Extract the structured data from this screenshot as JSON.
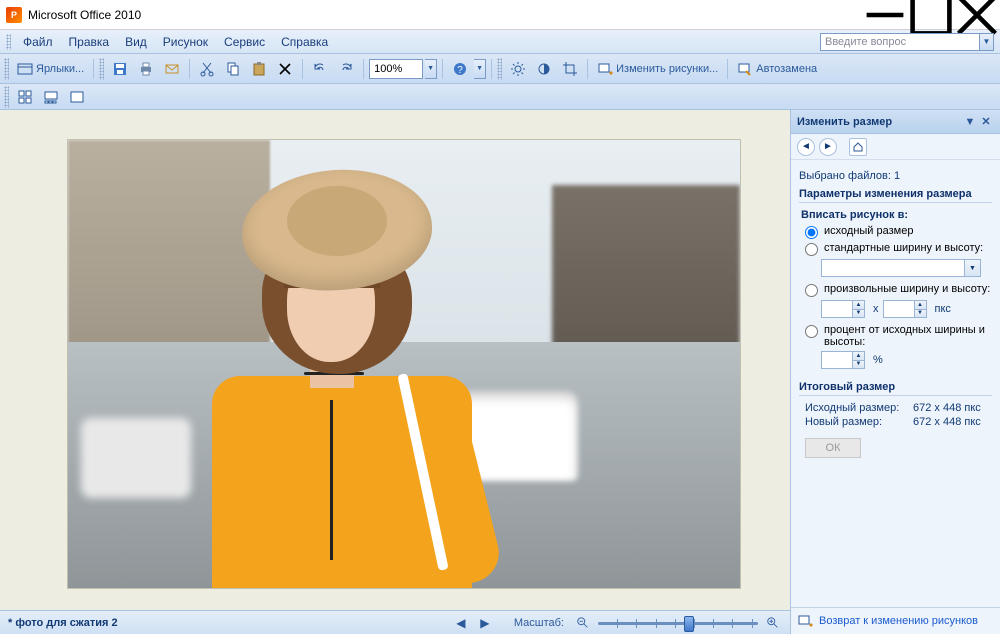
{
  "app": {
    "title": "Microsoft Office 2010"
  },
  "menu": {
    "file": "Файл",
    "edit": "Правка",
    "view": "Вид",
    "picture": "Рисунок",
    "service": "Сервис",
    "help": "Справка",
    "ask_placeholder": "Введите вопрос"
  },
  "toolbar": {
    "shortcuts": "Ярлыки...",
    "zoom_value": "100%",
    "edit_pictures": "Изменить рисунки...",
    "autocorrect": "Автозамена"
  },
  "panel": {
    "title": "Изменить размер",
    "selected_prefix": "Выбрано файлов:",
    "selected_count": "1",
    "params_title": "Параметры изменения размера",
    "fit_label": "Вписать рисунок в:",
    "opt_original": "исходный размер",
    "opt_standard": "стандартные ширину и высоту:",
    "opt_custom": "произвольные ширину и высоту:",
    "opt_percent": "процент от исходных ширины и высоты:",
    "by": "x",
    "px": "пкс",
    "pct": "%",
    "result_title": "Итоговый размер",
    "orig_label": "Исходный размер:",
    "orig_value": "672 x 448 пкс",
    "new_label": "Новый размер:",
    "new_value": "672 x 448 пкс",
    "ok": "ОК",
    "return_link": "Возврат к изменению рисунков"
  },
  "status": {
    "filename": "* фото для сжатия 2",
    "scale_label": "Масштаб:"
  }
}
